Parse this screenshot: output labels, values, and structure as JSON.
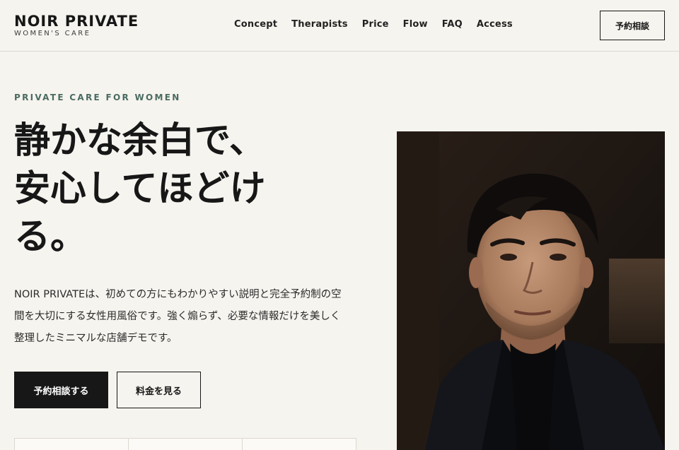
{
  "brand": {
    "name": "NOIR PRIVATE",
    "tagline": "WOMEN'S CARE"
  },
  "nav": {
    "items": [
      "Concept",
      "Therapists",
      "Price",
      "Flow",
      "FAQ",
      "Access"
    ]
  },
  "header": {
    "cta_label": "予約相談"
  },
  "hero": {
    "eyebrow": "PRIVATE CARE FOR WOMEN",
    "headline_lines": [
      "静かな余白で、",
      "安心してほどけ",
      "る。"
    ],
    "lead_lines": [
      "NOIR PRIVATEは、初めての方にもわかりやすい説明と完全予約制の空",
      "間を大切にする女性用風俗です。強く煽らず、必要な情報だけを美しく",
      "整理したミニマルな店舗デモです。"
    ],
    "primary_cta": "予約相談する",
    "secondary_cta": "料金を見る"
  },
  "colors": {
    "background": "#f6f4ef",
    "ink": "#171717",
    "accent": "#4a6b62"
  }
}
